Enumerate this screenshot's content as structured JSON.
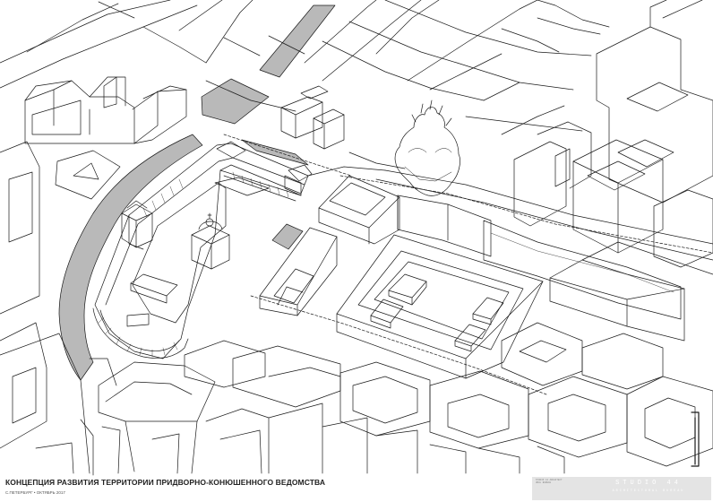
{
  "caption": {
    "title": "КОНЦЕПЦИЯ РАЗВИТИЯ ТЕРРИТОРИИ ПРИДВОРНО-КОНЮШЕННОГО ВЕДОМСТВА",
    "subtitle": "С.ПЕТЕРБУРГ • ОКТЯБРЬ 2017"
  },
  "studio": {
    "name": "STUDIO 44",
    "subtitle": "ARCHITECTURAL BUREAU",
    "small_text": "STUDIO 44 ARCHITECTURAL BUREAU"
  },
  "colors": {
    "canal_fill": "#b9b9b9",
    "line": "#1a1a1a",
    "background": "#ffffff",
    "studio_panel": "#e4e4e4"
  }
}
